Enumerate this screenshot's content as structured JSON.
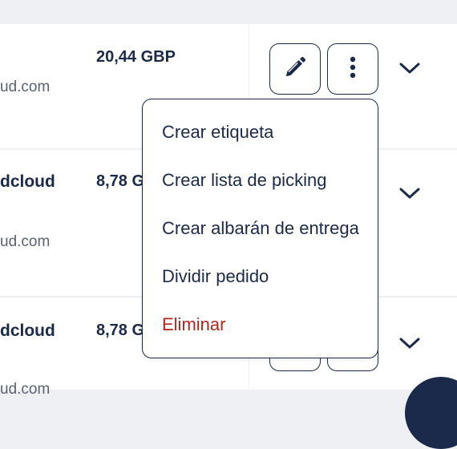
{
  "orders": [
    {
      "name": "",
      "email": "ud.com",
      "amount": "20,44 GBP"
    },
    {
      "name": "dcloud",
      "email": "ud.com",
      "amount": "8,78 G"
    },
    {
      "name": "dcloud",
      "email": "ud.com",
      "amount": "8,78 G"
    }
  ],
  "actions": {
    "edit_icon": "pencil-icon",
    "more_icon": "more-vertical-icon",
    "expand_icon": "chevron-down-icon"
  },
  "menu": {
    "items": [
      {
        "label": "Crear etiqueta"
      },
      {
        "label": "Crear lista de picking"
      },
      {
        "label": "Crear albarán de entrega"
      },
      {
        "label": "Dividir pedido"
      },
      {
        "label": "Eliminar",
        "danger": true
      }
    ]
  },
  "colors": {
    "primary": "#1b2a4a",
    "danger": "#b3261e",
    "muted_text": "#5a6173",
    "background": "#eef0f4"
  }
}
